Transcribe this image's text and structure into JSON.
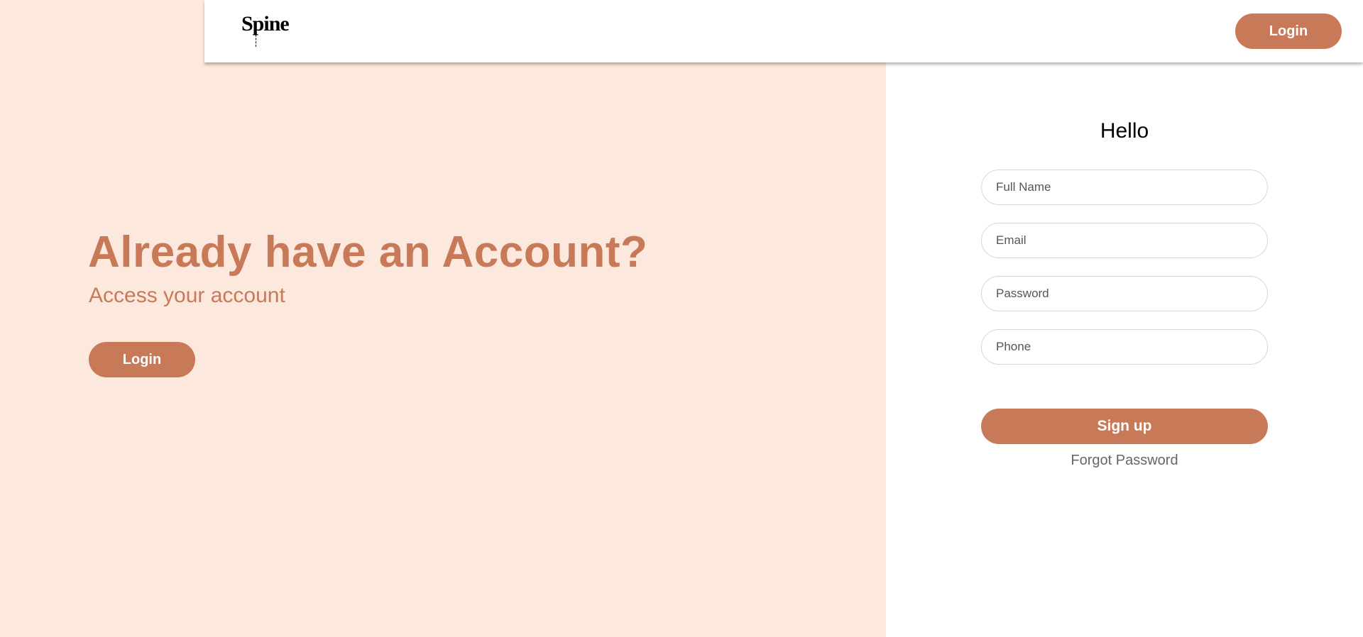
{
  "brand": {
    "logo_text": "Spine",
    "accent_color": "#c87a58",
    "panel_background": "#fde8dd"
  },
  "navbar": {
    "login_label": "Login"
  },
  "hero": {
    "headline": "Already have an Account?",
    "subheadline": "Access your account",
    "login_label": "Login"
  },
  "signup_form": {
    "title": "Hello",
    "full_name_placeholder": "Full Name",
    "email_placeholder": "Email",
    "password_placeholder": "Password",
    "phone_placeholder": "Phone",
    "submit_label": "Sign up",
    "forgot_password_label": "Forgot Password"
  }
}
